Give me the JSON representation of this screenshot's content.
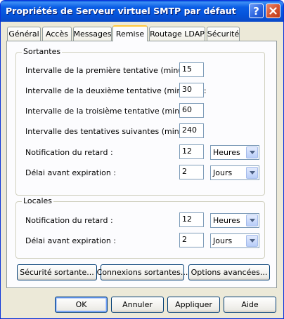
{
  "window": {
    "title": "Propriétés de Serveur virtuel SMTP par défaut"
  },
  "titlebar": {
    "help_glyph": "?",
    "help_icon": "help-icon",
    "close_icon": "close-icon"
  },
  "tabs": [
    {
      "label": "Général"
    },
    {
      "label": "Accès"
    },
    {
      "label": "Messages"
    },
    {
      "label": "Remise",
      "active": true
    },
    {
      "label": "Routage LDAP"
    },
    {
      "label": "Sécurité"
    }
  ],
  "outbound": {
    "title": "Sortantes",
    "first_retry_label": "Intervalle de la première tentative (minutes) :",
    "first_retry_value": "15",
    "second_retry_label": "Intervalle de la deuxième tentative (minutes) :",
    "second_retry_value": "30",
    "third_retry_label": "Intervalle de la troisième tentative (minutes) :",
    "third_retry_value": "60",
    "subsequent_retry_label": "Intervalle des tentatives suivantes (minutes) :",
    "subsequent_retry_value": "240",
    "delay_notification_label": "Notification du retard :",
    "delay_notification_value": "12",
    "delay_notification_unit": "Heures",
    "expiration_label": "Délai avant expiration :",
    "expiration_value": "2",
    "expiration_unit": "Jours"
  },
  "local": {
    "title": "Locales",
    "delay_notification_label": "Notification du retard :",
    "delay_notification_value": "12",
    "delay_notification_unit": "Heures",
    "expiration_label": "Délai avant expiration :",
    "expiration_value": "2",
    "expiration_unit": "Jours"
  },
  "actions": {
    "outbound_security": "Sécurité sortante...",
    "outbound_connections": "Connexions sortantes...",
    "advanced_options": "Options avancées..."
  },
  "footer": {
    "ok": "OK",
    "cancel": "Annuler",
    "apply": "Appliquer",
    "help": "Aide"
  },
  "colors": {
    "titlebar_blue": "#0553d9",
    "tab_highlight": "#ffc83c",
    "dialog_face": "#ece9d8"
  }
}
